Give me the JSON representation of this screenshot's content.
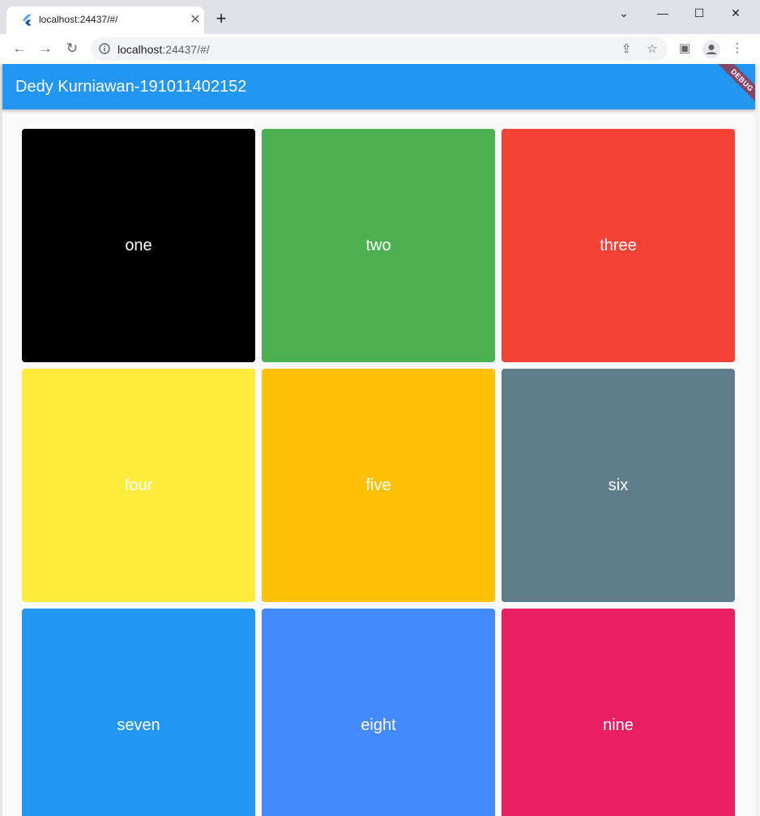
{
  "browser": {
    "tab_title": "localhost:24437/#/",
    "tab_close": "✕",
    "new_tab": "+",
    "url_host": "localhost",
    "url_rest": ":24437/#/",
    "window_controls": {
      "dropdown": "⌄",
      "minimize": "—",
      "maximize": "☐",
      "close": "✕"
    },
    "nav": {
      "back": "←",
      "forward": "→",
      "reload": "↻"
    },
    "icons": {
      "share": "⇪",
      "bookmark": "☆",
      "side_panel": "▣",
      "menu": "⋮"
    }
  },
  "app": {
    "title": "Dedy Kurniawan-191011402152",
    "debug_banner": "DEBUG",
    "accent_color": "#2196f3",
    "tiles": [
      {
        "label": "one",
        "color": "#000000"
      },
      {
        "label": "two",
        "color": "#4caf50"
      },
      {
        "label": "three",
        "color": "#f44336"
      },
      {
        "label": "four",
        "color": "#ffeb3b"
      },
      {
        "label": "five",
        "color": "#ffc107"
      },
      {
        "label": "six",
        "color": "#607d8b"
      },
      {
        "label": "seven",
        "color": "#2196f3"
      },
      {
        "label": "eight",
        "color": "#448aff"
      },
      {
        "label": "nine",
        "color": "#e91e63"
      }
    ]
  }
}
